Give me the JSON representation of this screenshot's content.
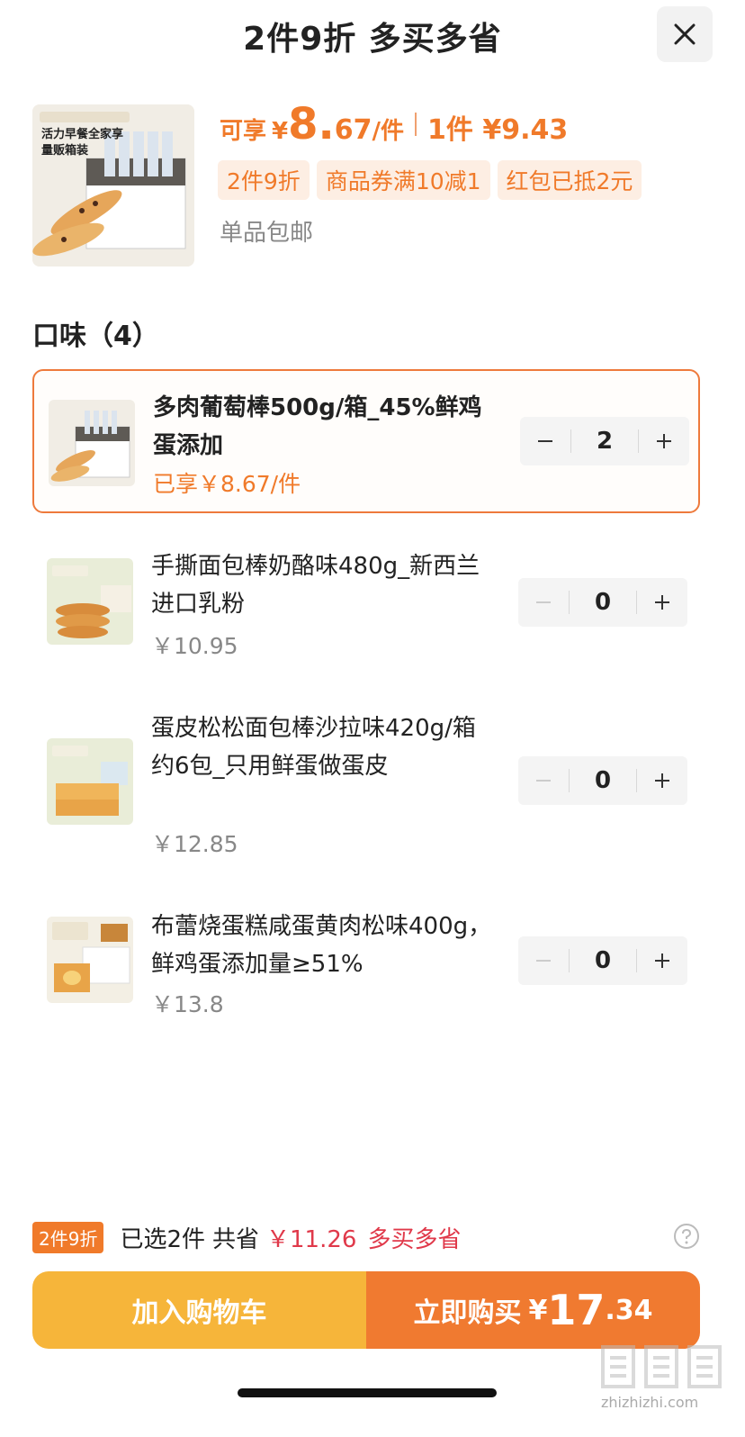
{
  "header": {
    "title": "2件9折 多买多省",
    "close_icon": "close-icon"
  },
  "product": {
    "price_label": "可享",
    "yen": "¥",
    "price_int": "8.",
    "price_dec": "67",
    "price_unit": "/件",
    "one_label": "1件 ¥9.43",
    "tags": [
      "2件9折",
      "商品券满10减1",
      "红包已抵2元"
    ],
    "shipping": "单品包邮",
    "image_caption_1": "活力早餐全家享",
    "image_caption_2": "量贩箱装"
  },
  "section": {
    "title": "口味（4）"
  },
  "options": [
    {
      "name": "多肉葡萄棒500g/箱_45%鲜鸡蛋添加",
      "price": "已享￥8.67/件",
      "qty": "2",
      "selected": true
    },
    {
      "name": "手撕面包棒奶酪味480g_新西兰进口乳粉",
      "price": "￥10.95",
      "qty": "0",
      "selected": false
    },
    {
      "name": "蛋皮松松面包棒沙拉味420g/箱约6包_只用鲜蛋做蛋皮",
      "price": "￥12.85",
      "qty": "0",
      "selected": false
    },
    {
      "name": "布蕾烧蛋糕咸蛋黄肉松味400g，鲜鸡蛋添加量≥51%",
      "price": "￥13.8",
      "qty": "0",
      "selected": false
    }
  ],
  "summary": {
    "badge": "2件9折",
    "selected": "已选2件",
    "save_label": "共省",
    "save_value": "￥11.26",
    "more": "多买多省",
    "help_icon": "help-circle-icon"
  },
  "buttons": {
    "cart": "加入购物车",
    "buy_label": "立即购买",
    "buy_yen": "¥",
    "buy_int": "17",
    "buy_dec": ".34"
  },
  "watermark": "zhizhizhi.com",
  "colors": {
    "accent": "#f07a2a",
    "cart": "#f6b53a",
    "buy": "#f07a30",
    "save": "#e0394a"
  }
}
